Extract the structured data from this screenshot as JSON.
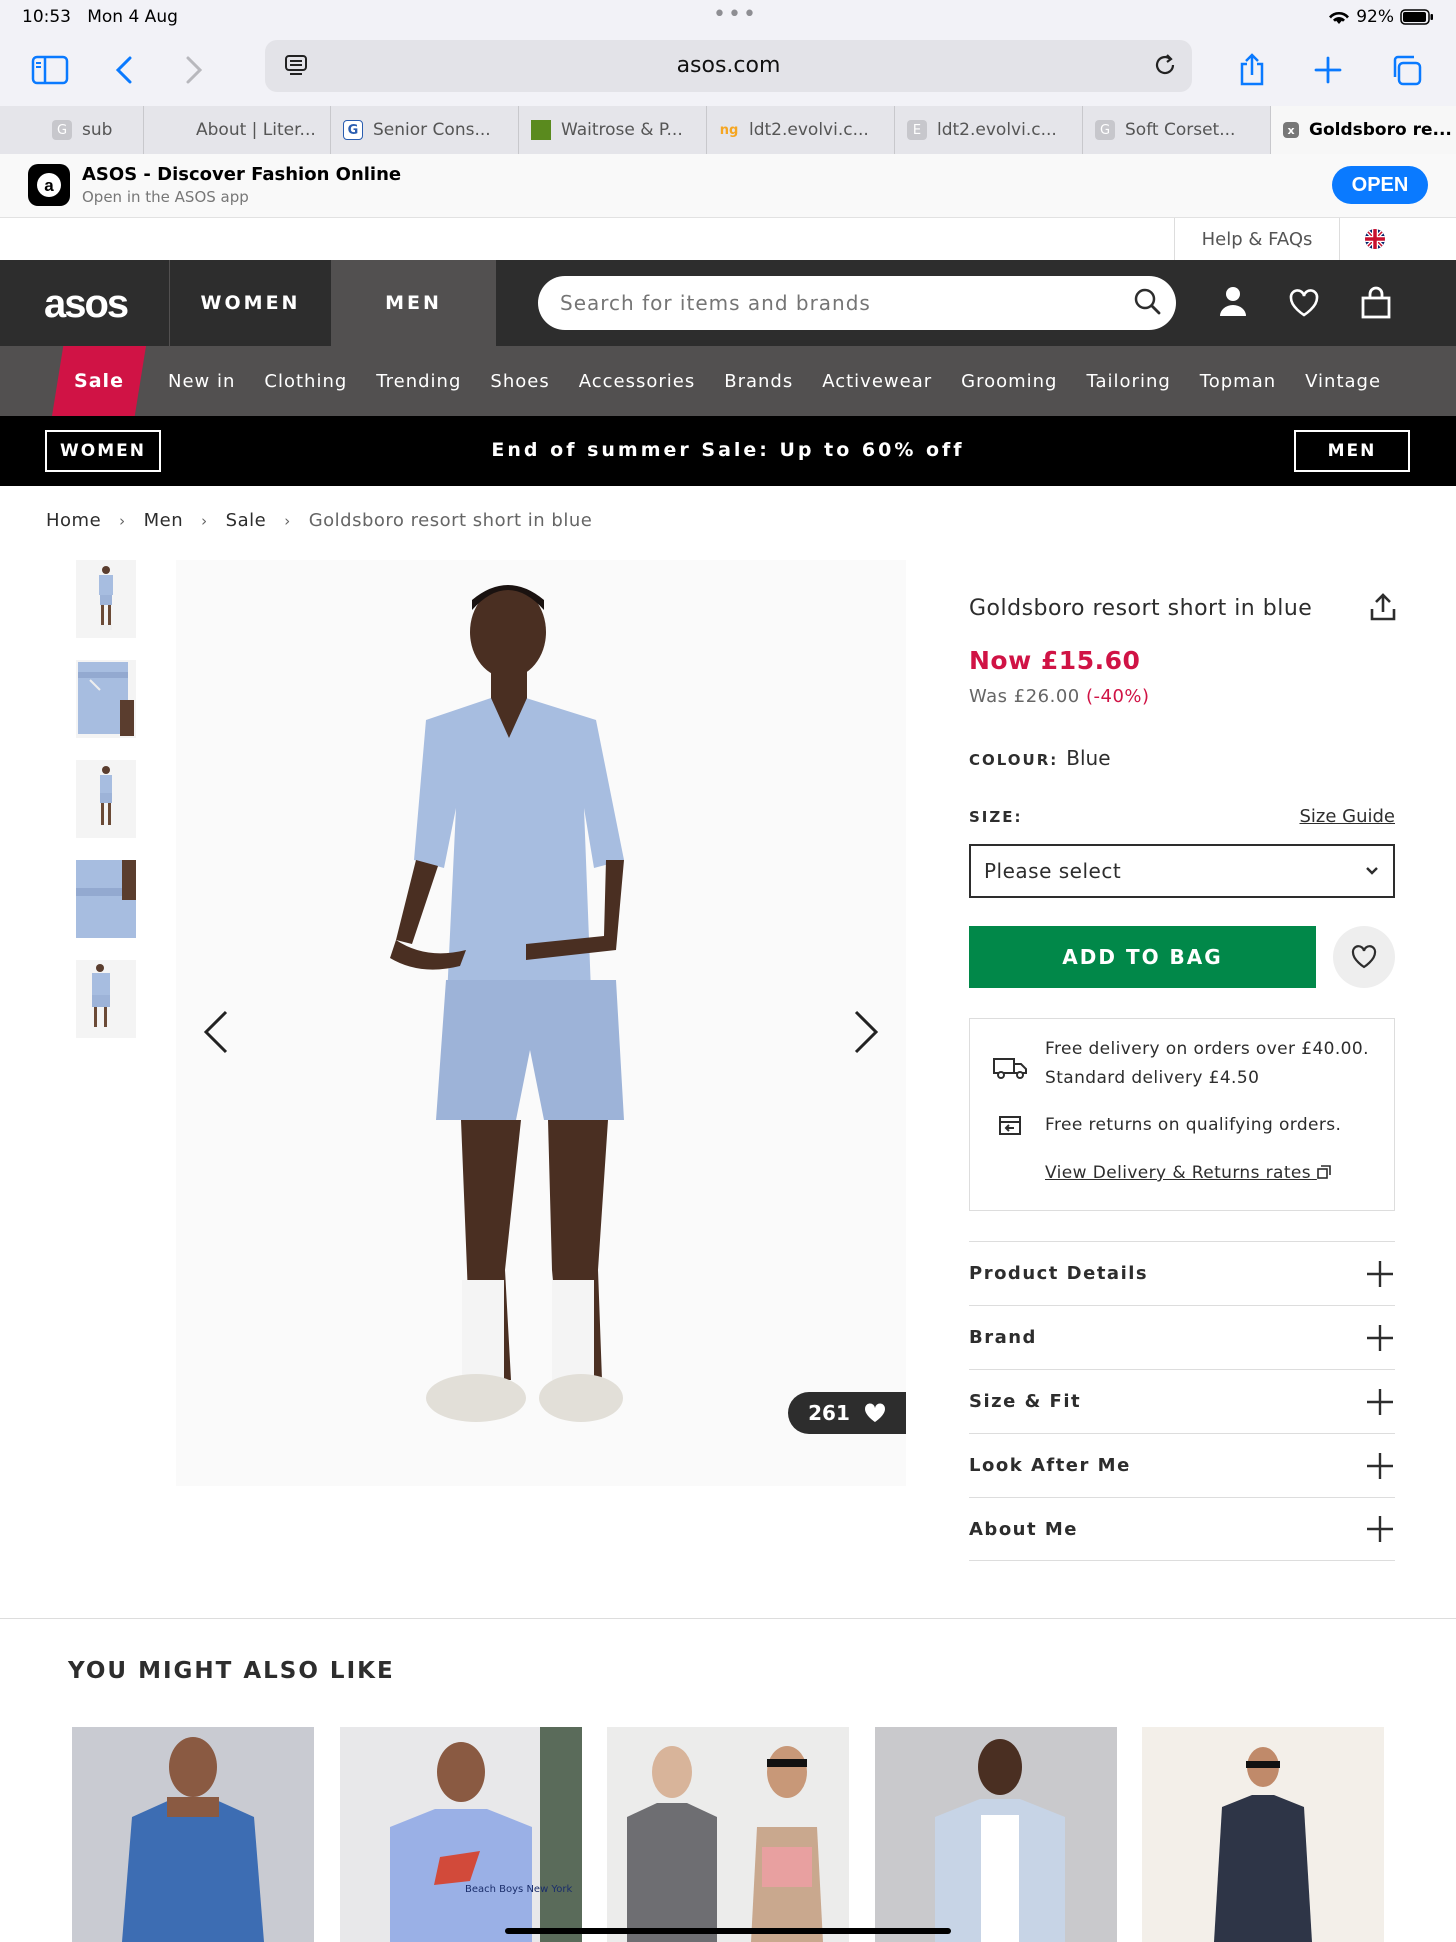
{
  "status": {
    "time": "10:53",
    "date": "Mon 4 Aug",
    "battery": "92%"
  },
  "browser": {
    "url": "asos.com"
  },
  "tabs": [
    {
      "label": "sub",
      "fav": "G"
    },
    {
      "label": "About | Liter...",
      "fav": ""
    },
    {
      "label": "Senior Cons...",
      "fav": "G"
    },
    {
      "label": "Waitrose & P...",
      "fav": ""
    },
    {
      "label": "ldt2.evolvi.c...",
      "fav": "ng"
    },
    {
      "label": "ldt2.evolvi.c...",
      "fav": "E"
    },
    {
      "label": "Soft Corset...",
      "fav": "G"
    },
    {
      "label": "Goldsboro re...",
      "fav": "x"
    }
  ],
  "banner": {
    "title": "ASOS - Discover Fashion Online",
    "subtitle": "Open in the ASOS app",
    "open": "OPEN"
  },
  "help": {
    "label": "Help & FAQs"
  },
  "nav": {
    "brand": "asos",
    "women": "WOMEN",
    "men": "MEN",
    "search_placeholder": "Search for items and brands"
  },
  "categories": {
    "sale": "Sale",
    "items": [
      "New in",
      "Clothing",
      "Trending",
      "Shoes",
      "Accessories",
      "Brands",
      "Activewear",
      "Grooming",
      "Tailoring",
      "Topman",
      "Vintage"
    ]
  },
  "promo": {
    "women": "WOMEN",
    "message": "End of summer Sale: Up to 60% off",
    "men": "MEN"
  },
  "breadcrumb": [
    "Home",
    "Men",
    "Sale",
    "Goldsboro resort short in blue"
  ],
  "product": {
    "title": "Goldsboro resort short in blue",
    "now": "Now £15.60",
    "was": "Was £26.00",
    "discount": "(-40%)",
    "colour_label": "COLOUR:",
    "colour": "Blue",
    "size_label": "SIZE:",
    "size_guide": "Size Guide",
    "size_placeholder": "Please select",
    "add_to_bag": "ADD TO BAG",
    "likes": "261",
    "delivery_line1": "Free delivery on orders over £40.00.",
    "delivery_line2": "Standard delivery £4.50",
    "returns": "Free returns on qualifying orders.",
    "rates_link": "View Delivery & Returns rates",
    "accordion": [
      "Product Details",
      "Brand",
      "Size & Fit",
      "Look After Me",
      "About Me"
    ]
  },
  "recommendations": {
    "title": "YOU MIGHT ALSO LIKE",
    "tshirt_text": "Beach Boys New York"
  },
  "colors": {
    "accent_sale": "#d01345",
    "add_to_bag": "#018849",
    "nav_dark": "#2d2d2d",
    "nav_mid": "#525050",
    "safari_blue": "#0a7aff",
    "shirt_blue": "#a7bde0"
  }
}
